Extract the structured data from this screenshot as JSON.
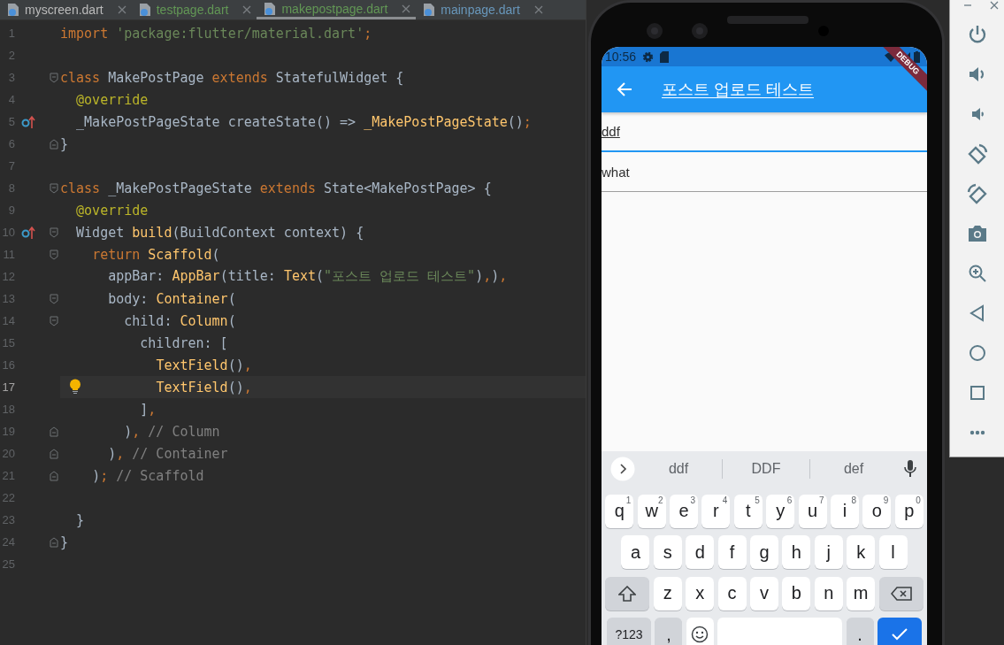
{
  "editor": {
    "tabs": [
      {
        "label": "myscreen.dart",
        "color": "#bbbbbb",
        "selected": false
      },
      {
        "label": "testpage.dart",
        "color": "#629755",
        "selected": false
      },
      {
        "label": "makepostpage.dart",
        "color": "#629755",
        "selected": true
      },
      {
        "label": "mainpage.dart",
        "color": "#6897bb",
        "selected": false
      }
    ],
    "lines": [
      {
        "number": "1",
        "current": false,
        "override_mark": false,
        "bulb": false,
        "fold_start": false,
        "fold_end": false,
        "tokens": [
          {
            "kind": "keyword",
            "text": "import"
          },
          {
            "kind": "string",
            "text": " 'package:flutter/material.dart'"
          },
          {
            "kind": "keyword",
            "text": ";"
          }
        ]
      },
      {
        "number": "2",
        "current": false,
        "override_mark": false,
        "bulb": false,
        "fold_start": false,
        "fold_end": false
      },
      {
        "number": "3",
        "current": false,
        "override_mark": false,
        "bulb": false,
        "fold_start": true,
        "fold_end": false,
        "tokens": [
          {
            "kind": "keyword",
            "text": "class"
          },
          {
            "kind": "plain",
            "text": " MakePostPage "
          },
          {
            "kind": "keyword",
            "text": "extends"
          },
          {
            "kind": "plain",
            "text": " StatefulWidget {"
          }
        ]
      },
      {
        "number": "4",
        "current": false,
        "override_mark": false,
        "bulb": false,
        "fold_start": false,
        "fold_end": false,
        "tokens": [
          {
            "kind": "annotation",
            "text": "  @override"
          }
        ]
      },
      {
        "number": "5",
        "current": false,
        "override_mark": true,
        "bulb": false,
        "fold_start": false,
        "fold_end": false,
        "tokens": [
          {
            "kind": "plain",
            "text": "  _MakePostPageState createState() => "
          },
          {
            "kind": "call",
            "text": "_MakePostPageState"
          },
          {
            "kind": "plain",
            "text": "()"
          },
          {
            "kind": "keyword",
            "text": ";"
          }
        ]
      },
      {
        "number": "6",
        "current": false,
        "override_mark": false,
        "bulb": false,
        "fold_start": false,
        "fold_end": true,
        "tokens": [
          {
            "kind": "plain",
            "text": "}"
          }
        ]
      },
      {
        "number": "7",
        "current": false,
        "override_mark": false,
        "bulb": false,
        "fold_start": false,
        "fold_end": false
      },
      {
        "number": "8",
        "current": false,
        "override_mark": false,
        "bulb": false,
        "fold_start": true,
        "fold_end": false,
        "tokens": [
          {
            "kind": "keyword",
            "text": "class"
          },
          {
            "kind": "plain",
            "text": " _MakePostPageState "
          },
          {
            "kind": "keyword",
            "text": "extends"
          },
          {
            "kind": "plain",
            "text": " State<MakePostPage> {"
          }
        ]
      },
      {
        "number": "9",
        "current": false,
        "override_mark": false,
        "bulb": false,
        "fold_start": false,
        "fold_end": false,
        "tokens": [
          {
            "kind": "annotation",
            "text": "  @override"
          }
        ]
      },
      {
        "number": "10",
        "current": false,
        "override_mark": true,
        "bulb": false,
        "fold_start": true,
        "fold_end": false,
        "tokens": [
          {
            "kind": "plain",
            "text": "  Widget "
          },
          {
            "kind": "call",
            "text": "build"
          },
          {
            "kind": "plain",
            "text": "(BuildContext context) {"
          }
        ]
      },
      {
        "number": "11",
        "current": false,
        "override_mark": false,
        "bulb": false,
        "fold_start": true,
        "fold_end": false,
        "tokens": [
          {
            "kind": "keyword",
            "text": "    return"
          },
          {
            "kind": "call",
            "text": " Scaffold"
          },
          {
            "kind": "plain",
            "text": "("
          }
        ]
      },
      {
        "number": "12",
        "current": false,
        "override_mark": false,
        "bulb": false,
        "fold_start": false,
        "fold_end": false,
        "tokens": [
          {
            "kind": "plain",
            "text": "      appBar: "
          },
          {
            "kind": "call",
            "text": "AppBar"
          },
          {
            "kind": "plain",
            "text": "(title: "
          },
          {
            "kind": "call",
            "text": "Text"
          },
          {
            "kind": "plain",
            "text": "("
          },
          {
            "kind": "string",
            "text": "\"포스트 업로드 테스트\""
          },
          {
            "kind": "plain",
            "text": ")"
          },
          {
            "kind": "keyword",
            "text": ","
          },
          {
            "kind": "plain",
            "text": ")"
          },
          {
            "kind": "keyword",
            "text": ","
          }
        ]
      },
      {
        "number": "13",
        "current": false,
        "override_mark": false,
        "bulb": false,
        "fold_start": true,
        "fold_end": false,
        "tokens": [
          {
            "kind": "plain",
            "text": "      body: "
          },
          {
            "kind": "call",
            "text": "Container"
          },
          {
            "kind": "plain",
            "text": "("
          }
        ]
      },
      {
        "number": "14",
        "current": false,
        "override_mark": false,
        "bulb": false,
        "fold_start": true,
        "fold_end": false,
        "tokens": [
          {
            "kind": "plain",
            "text": "        child: "
          },
          {
            "kind": "call",
            "text": "Column"
          },
          {
            "kind": "plain",
            "text": "("
          }
        ]
      },
      {
        "number": "15",
        "current": false,
        "override_mark": false,
        "bulb": false,
        "fold_start": false,
        "fold_end": false,
        "tokens": [
          {
            "kind": "plain",
            "text": "          children: ["
          }
        ]
      },
      {
        "number": "16",
        "current": false,
        "override_mark": false,
        "bulb": false,
        "fold_start": false,
        "fold_end": false,
        "tokens": [
          {
            "kind": "call",
            "text": "            TextField"
          },
          {
            "kind": "plain",
            "text": "()"
          },
          {
            "kind": "keyword",
            "text": ","
          }
        ]
      },
      {
        "number": "17",
        "current": true,
        "override_mark": false,
        "bulb": true,
        "fold_start": false,
        "fold_end": false,
        "tokens": [
          {
            "kind": "call",
            "text": "            TextField"
          },
          {
            "kind": "plain",
            "text": "()"
          },
          {
            "kind": "keyword",
            "text": ","
          }
        ]
      },
      {
        "number": "18",
        "current": false,
        "override_mark": false,
        "bulb": false,
        "fold_start": false,
        "fold_end": false,
        "tokens": [
          {
            "kind": "plain",
            "text": "          ]"
          },
          {
            "kind": "keyword",
            "text": ","
          }
        ]
      },
      {
        "number": "19",
        "current": false,
        "override_mark": false,
        "bulb": false,
        "fold_start": false,
        "fold_end": true,
        "tokens": [
          {
            "kind": "plain",
            "text": "        )"
          },
          {
            "kind": "keyword",
            "text": ","
          },
          {
            "kind": "comment",
            "text": " // Column"
          }
        ]
      },
      {
        "number": "20",
        "current": false,
        "override_mark": false,
        "bulb": false,
        "fold_start": false,
        "fold_end": true,
        "tokens": [
          {
            "kind": "plain",
            "text": "      )"
          },
          {
            "kind": "keyword",
            "text": ","
          },
          {
            "kind": "comment",
            "text": " // Container"
          }
        ]
      },
      {
        "number": "21",
        "current": false,
        "override_mark": false,
        "bulb": false,
        "fold_start": false,
        "fold_end": true,
        "tokens": [
          {
            "kind": "plain",
            "text": "    )"
          },
          {
            "kind": "keyword",
            "text": ";"
          },
          {
            "kind": "comment",
            "text": " // Scaffold"
          }
        ]
      },
      {
        "number": "22",
        "current": false,
        "override_mark": false,
        "bulb": false,
        "fold_start": false,
        "fold_end": false
      },
      {
        "number": "23",
        "current": false,
        "override_mark": false,
        "bulb": false,
        "fold_start": false,
        "fold_end": false,
        "tokens": [
          {
            "kind": "plain",
            "text": "  }"
          }
        ]
      },
      {
        "number": "24",
        "current": false,
        "override_mark": false,
        "bulb": false,
        "fold_start": false,
        "fold_end": true,
        "tokens": [
          {
            "kind": "plain",
            "text": "}"
          }
        ]
      },
      {
        "number": "25",
        "current": false,
        "override_mark": false,
        "bulb": false,
        "fold_start": false,
        "fold_end": false
      }
    ]
  },
  "phone": {
    "status_bar": {
      "time": "10:56"
    },
    "debug_banner": "DEBUG",
    "app_bar": {
      "title": "포스트 업로드 테스트"
    },
    "fields": [
      {
        "value": "ddf",
        "focused": true,
        "composing": true
      },
      {
        "value": "what",
        "focused": false,
        "composing": false
      }
    ],
    "keyboard": {
      "suggestions": [
        "ddf",
        "DDF",
        "def"
      ],
      "rows": [
        {
          "keys": [
            {
              "kind": "letter",
              "label": "q",
              "hint": "1"
            },
            {
              "kind": "letter",
              "label": "w",
              "hint": "2"
            },
            {
              "kind": "letter",
              "label": "e",
              "hint": "3"
            },
            {
              "kind": "letter",
              "label": "r",
              "hint": "4"
            },
            {
              "kind": "letter",
              "label": "t",
              "hint": "5"
            },
            {
              "kind": "letter",
              "label": "y",
              "hint": "6"
            },
            {
              "kind": "letter",
              "label": "u",
              "hint": "7"
            },
            {
              "kind": "letter",
              "label": "i",
              "hint": "8"
            },
            {
              "kind": "letter",
              "label": "o",
              "hint": "9"
            },
            {
              "kind": "letter",
              "label": "p",
              "hint": "0"
            }
          ]
        },
        {
          "keys": [
            {
              "kind": "letter",
              "label": "a"
            },
            {
              "kind": "letter",
              "label": "s"
            },
            {
              "kind": "letter",
              "label": "d"
            },
            {
              "kind": "letter",
              "label": "f"
            },
            {
              "kind": "letter",
              "label": "g"
            },
            {
              "kind": "letter",
              "label": "h"
            },
            {
              "kind": "letter",
              "label": "j"
            },
            {
              "kind": "letter",
              "label": "k"
            },
            {
              "kind": "letter",
              "label": "l"
            }
          ]
        },
        {
          "keys": [
            {
              "kind": "shift"
            },
            {
              "kind": "letter",
              "label": "z"
            },
            {
              "kind": "letter",
              "label": "x"
            },
            {
              "kind": "letter",
              "label": "c"
            },
            {
              "kind": "letter",
              "label": "v"
            },
            {
              "kind": "letter",
              "label": "b"
            },
            {
              "kind": "letter",
              "label": "n"
            },
            {
              "kind": "letter",
              "label": "m"
            },
            {
              "kind": "backspace"
            }
          ]
        },
        {
          "keys": [
            {
              "kind": "symbols",
              "label": "?123"
            },
            {
              "kind": "punct",
              "label": ","
            },
            {
              "kind": "emoji"
            },
            {
              "kind": "space"
            },
            {
              "kind": "punct",
              "label": "."
            },
            {
              "kind": "enter"
            }
          ]
        }
      ]
    }
  }
}
